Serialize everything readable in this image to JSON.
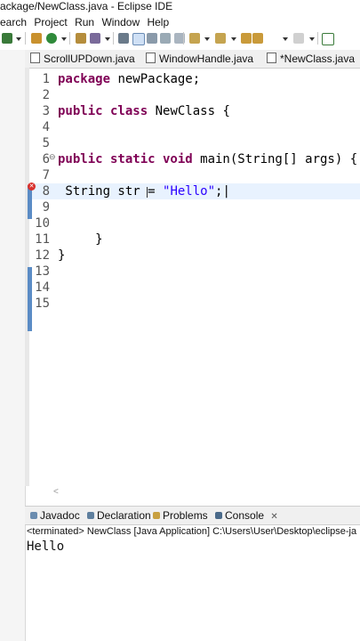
{
  "window": {
    "title": "ackage/NewClass.java - Eclipse IDE"
  },
  "menu": {
    "items": [
      "earch",
      "Project",
      "Run",
      "Window",
      "Help"
    ]
  },
  "editor_tabs": [
    {
      "label": "ScrollUPDown.java",
      "active": false
    },
    {
      "label": "WindowHandle.java",
      "active": false
    },
    {
      "label": "*NewClass.java",
      "active": true,
      "close": "✕"
    }
  ],
  "editor": {
    "lines": [
      {
        "num": "1",
        "tokens": [
          {
            "t": "package",
            "c": "kw"
          },
          {
            "t": " newPackage;",
            "c": ""
          }
        ]
      },
      {
        "num": "2",
        "tokens": []
      },
      {
        "num": "3",
        "tokens": [
          {
            "t": "public class",
            "c": "kw"
          },
          {
            "t": " NewClass {",
            "c": ""
          }
        ]
      },
      {
        "num": "4",
        "tokens": []
      },
      {
        "num": "5",
        "tokens": []
      },
      {
        "num": "6",
        "tokens": [
          {
            "t": "public static void",
            "c": "kw"
          },
          {
            "t": " main(String[] args) {",
            "c": ""
          }
        ]
      },
      {
        "num": "7",
        "tokens": []
      },
      {
        "num": "8",
        "tokens": [
          {
            "t": " String str = ",
            "c": ""
          },
          {
            "t": "\"Hello\"",
            "c": "str"
          },
          {
            "t": ";|",
            "c": ""
          }
        ]
      },
      {
        "num": "9",
        "tokens": []
      },
      {
        "num": "10",
        "tokens": []
      },
      {
        "num": "11",
        "tokens": [
          {
            "t": "     }",
            "c": ""
          }
        ]
      },
      {
        "num": "12",
        "tokens": [
          {
            "t": "}",
            "c": ""
          }
        ]
      },
      {
        "num": "13",
        "tokens": []
      },
      {
        "num": "14",
        "tokens": []
      },
      {
        "num": "15",
        "tokens": []
      }
    ],
    "fold_marker": "⊖",
    "error_marker": "✕",
    "scroll_arrow": "<"
  },
  "panel_tabs": [
    {
      "label": "Javadoc",
      "color": "#6a8caf"
    },
    {
      "label": "Declaration",
      "color": "#5e7f9e"
    },
    {
      "label": "Problems",
      "color": "#c8a040"
    },
    {
      "label": "Console",
      "color": "#4a6a8a",
      "active": true,
      "close": "✕"
    }
  ],
  "console": {
    "status": "<terminated> NewClass [Java Application] C:\\Users\\User\\Desktop\\eclipse-ja",
    "output": "Hello"
  },
  "colors": {
    "keyword": "#7f0055",
    "string": "#2a00ff",
    "highlight": "#e8f2fe",
    "error": "#d9302c"
  }
}
